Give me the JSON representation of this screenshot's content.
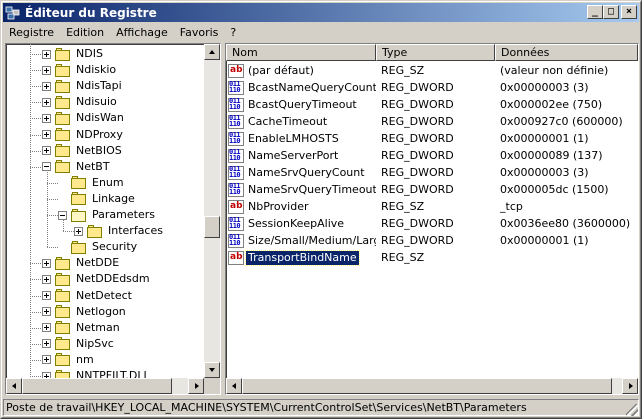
{
  "window": {
    "title": "Éditeur du Registre",
    "minimize_glyph": "_",
    "maximize_glyph": "□",
    "close_glyph": "×"
  },
  "menu": [
    "Registre",
    "Edition",
    "Affichage",
    "Favoris",
    "?"
  ],
  "tree": {
    "items": [
      {
        "label": "NDIS",
        "level": 0,
        "expander": "plus"
      },
      {
        "label": "Ndiskio",
        "level": 0,
        "expander": "plus"
      },
      {
        "label": "NdisTapi",
        "level": 0,
        "expander": "plus"
      },
      {
        "label": "Ndisuio",
        "level": 0,
        "expander": "plus"
      },
      {
        "label": "NdisWan",
        "level": 0,
        "expander": "plus"
      },
      {
        "label": "NDProxy",
        "level": 0,
        "expander": "plus"
      },
      {
        "label": "NetBIOS",
        "level": 0,
        "expander": "plus"
      },
      {
        "label": "NetBT",
        "level": 0,
        "expander": "minus"
      },
      {
        "label": "Enum",
        "level": 1,
        "expander": "none"
      },
      {
        "label": "Linkage",
        "level": 1,
        "expander": "none"
      },
      {
        "label": "Parameters",
        "level": 1,
        "expander": "minus",
        "open": true
      },
      {
        "label": "Interfaces",
        "level": 2,
        "expander": "plus"
      },
      {
        "label": "Security",
        "level": 1,
        "expander": "none"
      },
      {
        "label": "NetDDE",
        "level": 0,
        "expander": "plus"
      },
      {
        "label": "NetDDEdsdm",
        "level": 0,
        "expander": "plus"
      },
      {
        "label": "NetDetect",
        "level": 0,
        "expander": "plus"
      },
      {
        "label": "Netlogon",
        "level": 0,
        "expander": "plus"
      },
      {
        "label": "Netman",
        "level": 0,
        "expander": "plus"
      },
      {
        "label": "NipSvc",
        "level": 0,
        "expander": "plus"
      },
      {
        "label": "nm",
        "level": 0,
        "expander": "plus"
      },
      {
        "label": "NNTPFILT.DLL",
        "level": 0,
        "expander": "plus"
      }
    ]
  },
  "list": {
    "columns": [
      "Nom",
      "Type",
      "Données"
    ],
    "rows": [
      {
        "name": "(par défaut)",
        "type": "REG_SZ",
        "data": "(valeur non définie)",
        "icon": "string-value-icon"
      },
      {
        "name": "BcastNameQueryCount",
        "type": "REG_DWORD",
        "data": "0x00000003 (3)",
        "icon": "dword-value-icon"
      },
      {
        "name": "BcastQueryTimeout",
        "type": "REG_DWORD",
        "data": "0x000002ee (750)",
        "icon": "dword-value-icon"
      },
      {
        "name": "CacheTimeout",
        "type": "REG_DWORD",
        "data": "0x000927c0 (600000)",
        "icon": "dword-value-icon"
      },
      {
        "name": "EnableLMHOSTS",
        "type": "REG_DWORD",
        "data": "0x00000001 (1)",
        "icon": "dword-value-icon"
      },
      {
        "name": "NameServerPort",
        "type": "REG_DWORD",
        "data": "0x00000089 (137)",
        "icon": "dword-value-icon"
      },
      {
        "name": "NameSrvQueryCount",
        "type": "REG_DWORD",
        "data": "0x00000003 (3)",
        "icon": "dword-value-icon"
      },
      {
        "name": "NameSrvQueryTimeout",
        "type": "REG_DWORD",
        "data": "0x000005dc (1500)",
        "icon": "dword-value-icon"
      },
      {
        "name": "NbProvider",
        "type": "REG_SZ",
        "data": "_tcp",
        "icon": "string-value-icon"
      },
      {
        "name": "SessionKeepAlive",
        "type": "REG_DWORD",
        "data": "0x0036ee80 (3600000)",
        "icon": "dword-value-icon"
      },
      {
        "name": "Size/Small/Medium/Large",
        "type": "REG_DWORD",
        "data": "0x00000001 (1)",
        "icon": "dword-value-icon"
      },
      {
        "name": "TransportBindName",
        "type": "REG_SZ",
        "data": "",
        "icon": "string-value-icon",
        "selected": true
      }
    ]
  },
  "icons": {
    "sz_glyph": "ab",
    "dw_glyph": "011\n110"
  },
  "status": {
    "path": "Poste de travail\\HKEY_LOCAL_MACHINE\\SYSTEM\\CurrentControlSet\\Services\\NetBT\\Parameters"
  }
}
